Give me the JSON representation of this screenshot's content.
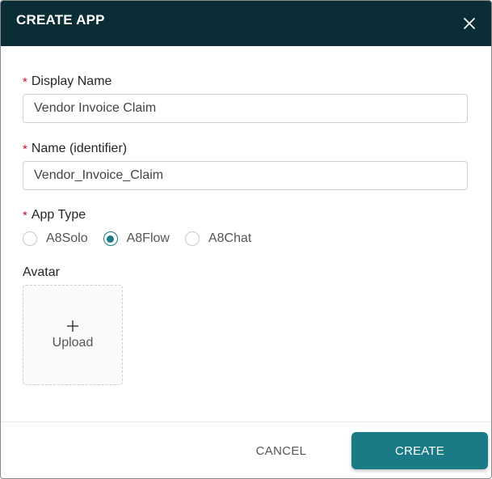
{
  "dialog": {
    "title": "CREATE APP",
    "close_icon": "close-icon"
  },
  "form": {
    "required_marker": "*",
    "display_name": {
      "label": "Display Name",
      "value": "Vendor Invoice Claim"
    },
    "identifier": {
      "label": "Name (identifier)",
      "value": "Vendor_Invoice_Claim"
    },
    "app_type": {
      "label": "App Type",
      "selected": "A8Flow",
      "options": [
        {
          "label": "A8Solo",
          "checked": false
        },
        {
          "label": "A8Flow",
          "checked": true
        },
        {
          "label": "A8Chat",
          "checked": false
        }
      ]
    },
    "avatar": {
      "label": "Avatar",
      "upload_icon": "plus-icon",
      "upload_label": "Upload"
    }
  },
  "footer": {
    "cancel_label": "CANCEL",
    "create_label": "CREATE"
  },
  "colors": {
    "header_bg": "#0b2e36",
    "accent": "#1a7a86",
    "required": "#c8102e"
  }
}
